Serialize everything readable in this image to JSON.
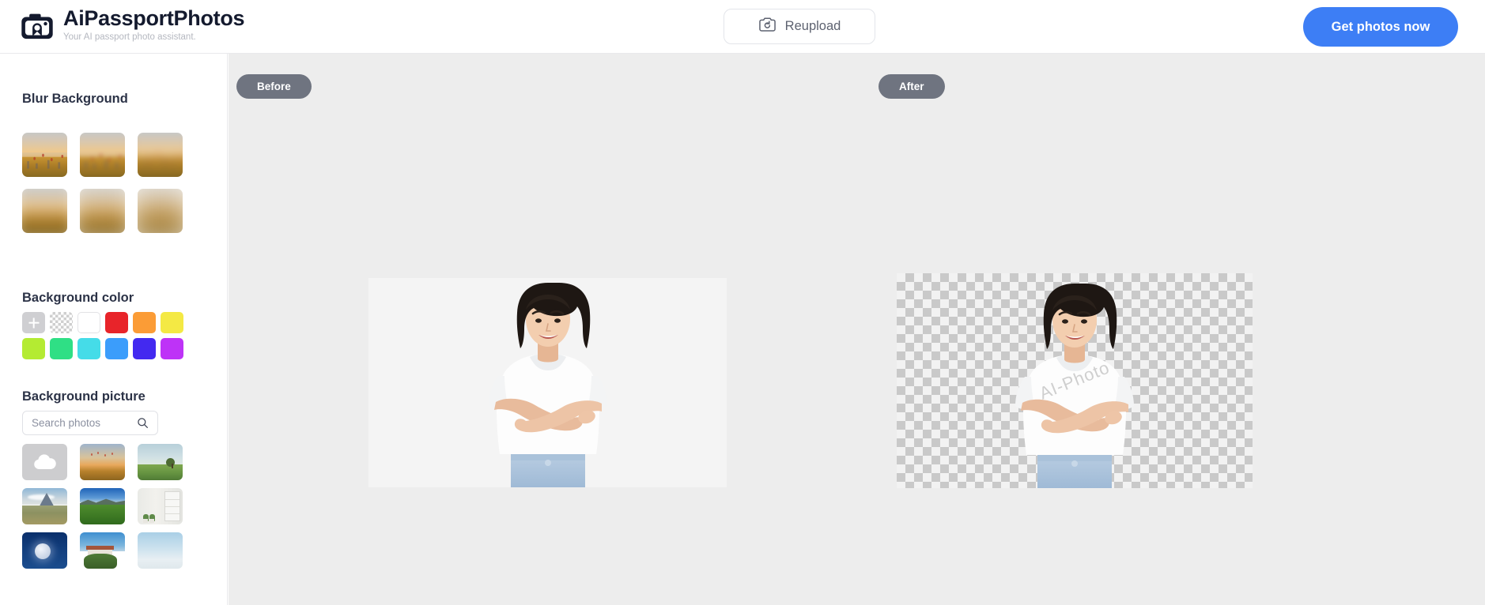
{
  "header": {
    "logo_icon": "camera-icon",
    "brand_title": "AiPassportPhotos",
    "brand_subtitle": "Your AI passport photo assistant.",
    "reupload_label": "Reupload",
    "reupload_icon": "camera-refresh-icon",
    "get_photos_label": "Get photos now",
    "accent_color": "#3d7ef5"
  },
  "sidebar": {
    "blur_section": {
      "title": "Blur Background",
      "thumbs": [
        {
          "name": "blur-level-0",
          "blur": 0
        },
        {
          "name": "blur-level-1",
          "blur": 2
        },
        {
          "name": "blur-level-2",
          "blur": 4
        },
        {
          "name": "blur-level-3",
          "blur": 7
        },
        {
          "name": "blur-level-4",
          "blur": 10
        },
        {
          "name": "blur-level-5",
          "blur": 13
        }
      ]
    },
    "color_section": {
      "title": "Background color",
      "swatches": [
        {
          "name": "add-custom-color",
          "type": "add",
          "color": "#cfcfd2"
        },
        {
          "name": "transparent",
          "type": "transparent",
          "color": "transparent"
        },
        {
          "name": "white",
          "type": "solid",
          "color": "#ffffff"
        },
        {
          "name": "red",
          "type": "solid",
          "color": "#e8242a"
        },
        {
          "name": "orange",
          "type": "solid",
          "color": "#fb9c36"
        },
        {
          "name": "yellow",
          "type": "solid",
          "color": "#f4e944"
        },
        {
          "name": "lime",
          "type": "solid",
          "color": "#b4eb32"
        },
        {
          "name": "green",
          "type": "solid",
          "color": "#2fdf85"
        },
        {
          "name": "cyan",
          "type": "solid",
          "color": "#45dce8"
        },
        {
          "name": "blue",
          "type": "solid",
          "color": "#3b9dfb"
        },
        {
          "name": "indigo",
          "type": "solid",
          "color": "#4329f0"
        },
        {
          "name": "magenta",
          "type": "solid",
          "color": "#be33f7"
        }
      ]
    },
    "picture_section": {
      "title": "Background picture",
      "search_placeholder": "Search photos",
      "search_value": "",
      "search_icon": "magnifier-icon",
      "photos": [
        {
          "name": "upload-photo",
          "scene": "upload",
          "label": "upload"
        },
        {
          "name": "photo-sunset-city",
          "scene": "a",
          "label": "sunset city"
        },
        {
          "name": "photo-lone-tree-field",
          "scene": "b",
          "label": "lone tree field"
        },
        {
          "name": "photo-mountain-peak",
          "scene": "c",
          "label": "mountain peak"
        },
        {
          "name": "photo-green-hills",
          "scene": "d",
          "label": "green hills"
        },
        {
          "name": "photo-indoor-shelf",
          "scene": "e",
          "label": "indoor shelf"
        },
        {
          "name": "photo-moon-night",
          "scene": "f",
          "label": "moon night"
        },
        {
          "name": "photo-house-garden",
          "scene": "g",
          "label": "house garden"
        },
        {
          "name": "photo-blue-sky",
          "scene": "h",
          "label": "blue sky"
        }
      ]
    }
  },
  "canvas": {
    "before_label": "Before",
    "after_label": "After",
    "background_color": "#ededed",
    "before_image_alt": "Smiling woman with bob haircut in white t-shirt, arms crossed, on white studio background",
    "after_image_alt": "Same woman with background removed shown on transparency checkerboard",
    "watermark_text": "AI-Photo"
  }
}
